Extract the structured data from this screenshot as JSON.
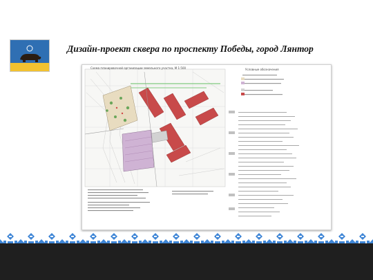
{
  "slide": {
    "title": "Дизайн-проект сквера по проспекту Победы, город Лянтор",
    "logo_icon": "bear-flag-icon",
    "colors": {
      "flag_blue": "#2f6fb3",
      "flag_yellow": "#f2c230",
      "ornament": "#3f86d6",
      "footer": "#1f1f1f"
    }
  },
  "plan": {
    "heading": "Схема планировочной организации земельного участка, М 1:500",
    "legend_heading": "Условные обозначения"
  }
}
